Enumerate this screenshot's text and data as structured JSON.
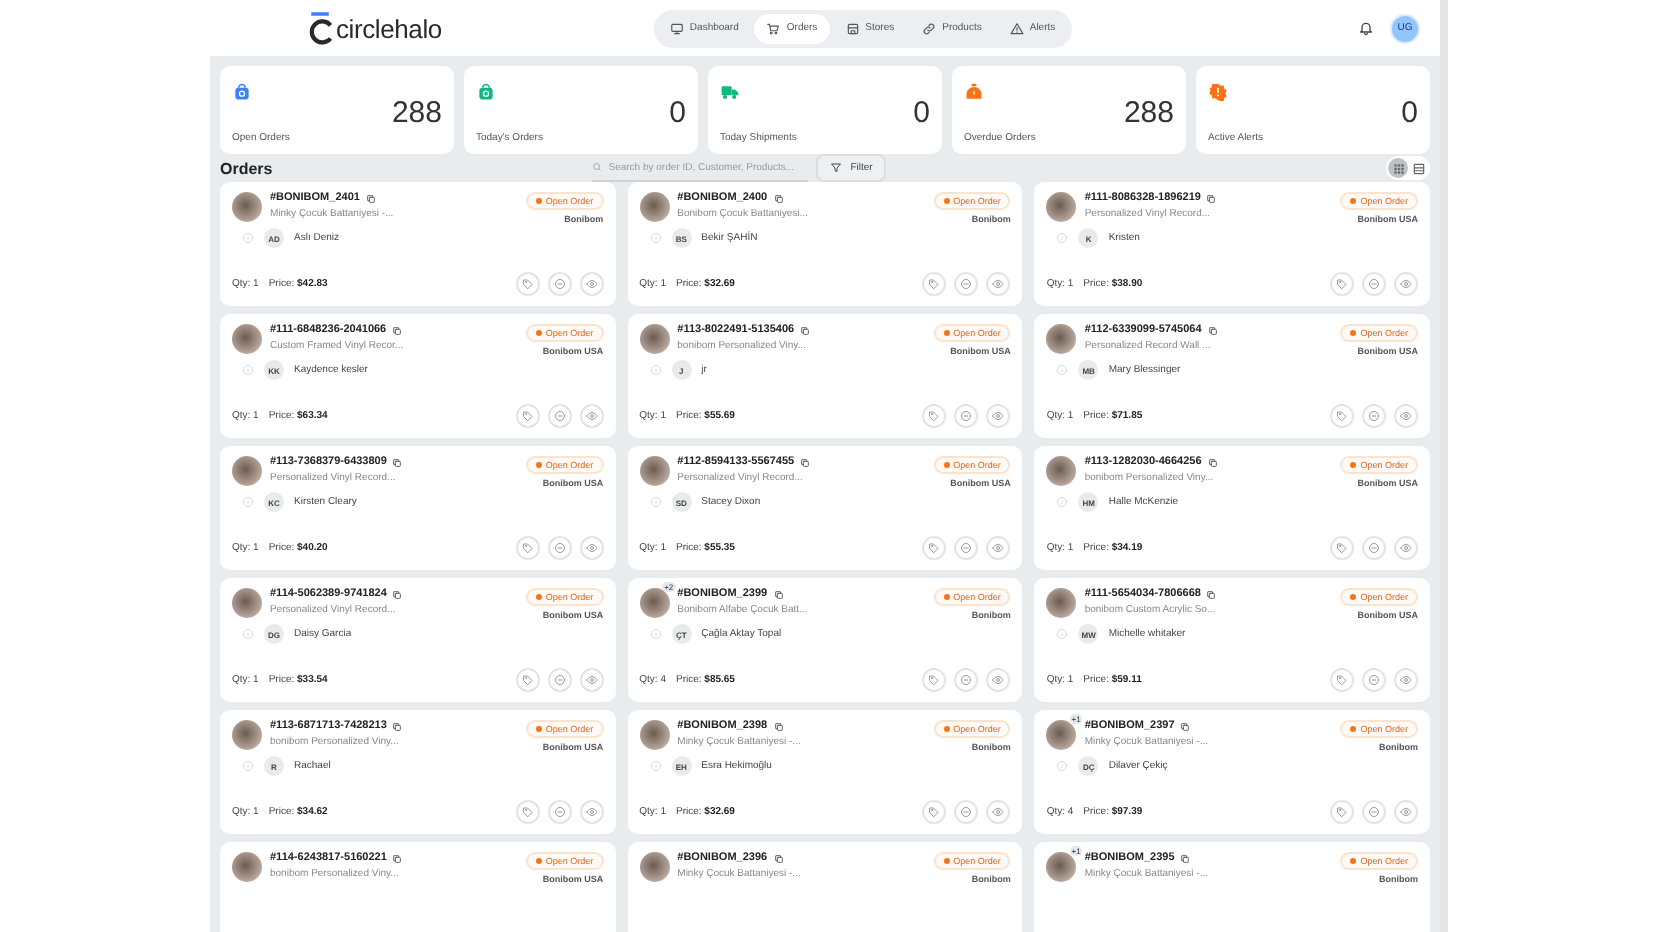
{
  "header": {
    "logo": "circlehalo",
    "nav": [
      {
        "label": "Dashboard",
        "kind": "monitor",
        "selected": false
      },
      {
        "label": "Orders",
        "kind": "cart",
        "selected": true
      },
      {
        "label": "Stores",
        "kind": "store",
        "selected": false
      },
      {
        "label": "Products",
        "kind": "link",
        "selected": false
      },
      {
        "label": "Alerts",
        "kind": "alert",
        "selected": false
      }
    ],
    "avatar": "UG"
  },
  "stats": [
    {
      "label": "Open Orders",
      "value": "288",
      "kind": "bag",
      "color": "#3b82f6"
    },
    {
      "label": "Today's Orders",
      "value": "0",
      "kind": "bag",
      "color": "#10b981"
    },
    {
      "label": "Today Shipments",
      "value": "0",
      "kind": "truck",
      "color": "#10b981"
    },
    {
      "label": "Overdue Orders",
      "value": "288",
      "kind": "timer",
      "color": "#f97316"
    },
    {
      "label": "Active Alerts",
      "value": "0",
      "kind": "alert",
      "color": "#f97316"
    }
  ],
  "orders": {
    "title": "Orders",
    "search": {
      "placeholder": "Search by order ID, Customer, Products..."
    },
    "filter": "Filter",
    "views": [
      {
        "kind": "grid",
        "selected": true
      },
      {
        "kind": "list",
        "selected": false
      }
    ],
    "cards": [
      {
        "id": "#BONIBOM_2401",
        "product": "Minky Çocuk Battaniyesi -...",
        "status": "Open Order",
        "store": "Bonibom",
        "initials": "AD",
        "customer": "Aslı Deniz",
        "qty": "Qty: 1",
        "price_label": "Price:",
        "price": "$42.83"
      },
      {
        "id": "#BONIBOM_2400",
        "product": "Bonibom Çocuk Battaniyesi...",
        "status": "Open Order",
        "store": "Bonibom",
        "initials": "BS",
        "customer": "Bekir ŞAHİN",
        "qty": "Qty: 1",
        "price_label": "Price:",
        "price": "$32.69"
      },
      {
        "id": "#111-8086328-1896219",
        "product": "Personalized Vinyl Record...",
        "status": "Open Order",
        "store": "Bonibom USA",
        "initials": "K",
        "customer": "Kristen",
        "qty": "Qty: 1",
        "price_label": "Price:",
        "price": "$38.90"
      },
      {
        "id": "#111-6848236-2041066",
        "product": "Custom Framed Vinyl Recor...",
        "status": "Open Order",
        "store": "Bonibom USA",
        "initials": "KK",
        "customer": "Kaydence kesler",
        "qty": "Qty: 1",
        "price_label": "Price:",
        "price": "$63.34"
      },
      {
        "id": "#113-8022491-5135406",
        "product": "bonibom Personalized Viny...",
        "status": "Open Order",
        "store": "Bonibom USA",
        "initials": "J",
        "customer": "jr",
        "qty": "Qty: 1",
        "price_label": "Price:",
        "price": "$55.69"
      },
      {
        "id": "#112-6339099-5745064",
        "product": "Personalized Record Wall ...",
        "status": "Open Order",
        "store": "Bonibom USA",
        "initials": "MB",
        "customer": "Mary Blessinger",
        "qty": "Qty: 1",
        "price_label": "Price:",
        "price": "$71.85"
      },
      {
        "id": "#113-7368379-6433809",
        "product": "Personalized Vinyl Record...",
        "status": "Open Order",
        "store": "Bonibom USA",
        "initials": "KC",
        "customer": "Kirsten Cleary",
        "qty": "Qty: 1",
        "price_label": "Price:",
        "price": "$40.20"
      },
      {
        "id": "#112-8594133-5567455",
        "product": "Personalized Vinyl Record...",
        "status": "Open Order",
        "store": "Bonibom USA",
        "initials": "SD",
        "customer": "Stacey Dixon",
        "qty": "Qty: 1",
        "price_label": "Price:",
        "price": "$55.35"
      },
      {
        "id": "#113-1282030-4664256",
        "product": "bonibom Personalized Viny...",
        "status": "Open Order",
        "store": "Bonibom USA",
        "initials": "HM",
        "customer": "Halle McKenzie",
        "qty": "Qty: 1",
        "price_label": "Price:",
        "price": "$34.19"
      },
      {
        "id": "#114-5062389-9741824",
        "product": "Personalized Vinyl Record...",
        "status": "Open Order",
        "store": "Bonibom USA",
        "initials": "DG",
        "customer": "Daisy Garcia",
        "qty": "Qty: 1",
        "price_label": "Price:",
        "price": "$33.54"
      },
      {
        "id": "#BONIBOM_2399",
        "extra": "+2",
        "product": "Bonibom Alfabe Çocuk Batt...",
        "status": "Open Order",
        "store": "Bonibom",
        "initials": "ÇT",
        "customer": "Çağla Aktay Topal",
        "qty": "Qty: 4",
        "price_label": "Price:",
        "price": "$85.65"
      },
      {
        "id": "#111-5654034-7806668",
        "product": "bonibom Custom Acrylic So...",
        "status": "Open Order",
        "store": "Bonibom USA",
        "initials": "MW",
        "customer": "Michelle whitaker",
        "qty": "Qty: 1",
        "price_label": "Price:",
        "price": "$59.11"
      },
      {
        "id": "#113-6871713-7428213",
        "product": "bonibom Personalized Viny...",
        "status": "Open Order",
        "store": "Bonibom USA",
        "initials": "R",
        "customer": "Rachael",
        "qty": "Qty: 1",
        "price_label": "Price:",
        "price": "$34.62"
      },
      {
        "id": "#BONIBOM_2398",
        "product": "Minky Çocuk Battaniyesi -...",
        "status": "Open Order",
        "store": "Bonibom",
        "initials": "EH",
        "customer": "Esra Hekimoğlu",
        "qty": "Qty: 1",
        "price_label": "Price:",
        "price": "$32.69"
      },
      {
        "id": "#BONIBOM_2397",
        "extra": "+1",
        "product": "Minky Çocuk Battaniyesi -...",
        "status": "Open Order",
        "store": "Bonibom",
        "initials": "DÇ",
        "customer": "Dilaver Çekiç",
        "qty": "Qty: 4",
        "price_label": "Price:",
        "price": "$97.39"
      },
      {
        "id": "#114-6243817-5160221",
        "product": "bonibom Personalized Viny...",
        "status": "Open Order",
        "store": "Bonibom USA"
      },
      {
        "id": "#BONIBOM_2396",
        "product": "Minky Çocuk Battaniyesi -...",
        "status": "Open Order",
        "store": "Bonibom"
      },
      {
        "id": "#BONIBOM_2395",
        "extra": "+1",
        "product": "Minky Çocuk Battaniyesi -...",
        "status": "Open Order",
        "store": "Bonibom"
      }
    ]
  }
}
